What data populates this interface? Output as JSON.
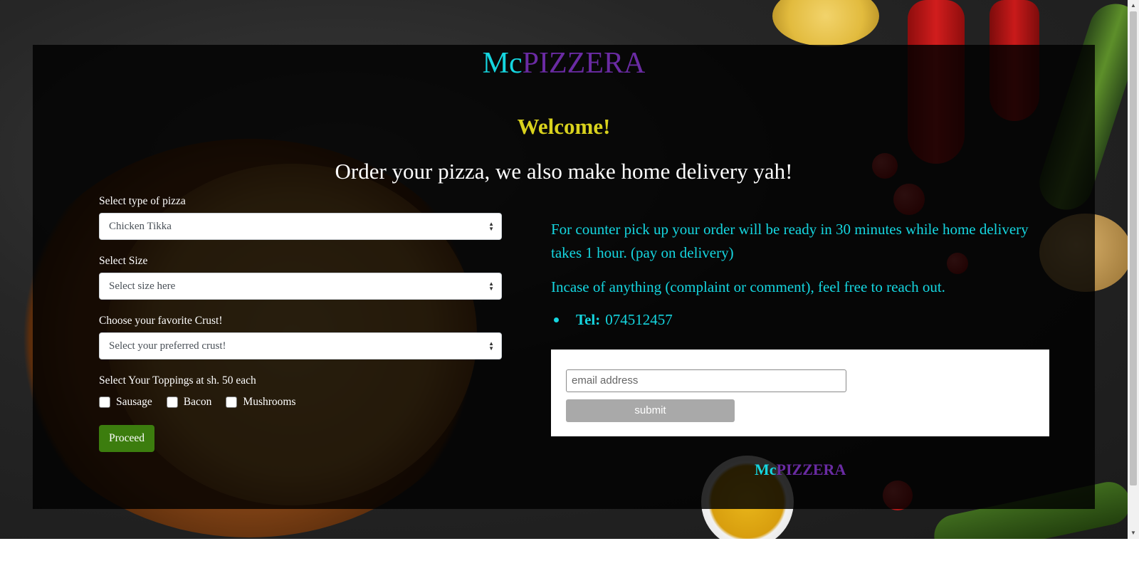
{
  "header": {
    "brand_prefix": "Mc",
    "brand_suffix": "PIZZERA",
    "welcome": "Welcome!",
    "subtitle": "Order your pizza, we also make home delivery yah!"
  },
  "form": {
    "pizza_type_label": "Select type of pizza",
    "pizza_type_value": "Chicken Tikka",
    "size_label": "Select Size",
    "size_value": "Select size here",
    "crust_label": "Choose your favorite Crust!",
    "crust_value": "Select your preferred crust!",
    "toppings_label": "Select Your Toppings at sh. 50 each",
    "toppings": [
      {
        "label": "Sausage",
        "checked": false
      },
      {
        "label": "Bacon",
        "checked": false
      },
      {
        "label": "Mushrooms",
        "checked": false
      }
    ],
    "proceed_label": "Proceed"
  },
  "info": {
    "delivery_text": "For counter pick up your order will be ready in 30 minutes while home delivery takes 1 hour. (pay on delivery)",
    "contact_text": "Incase of anything (complaint or comment), feel free to reach out.",
    "tel_label": "Tel:",
    "tel_value": "074512457"
  },
  "subscribe": {
    "email_placeholder": "email address",
    "submit_label": "submit"
  },
  "footer": {
    "brand_prefix": "Mc",
    "brand_suffix": "PIZZERA"
  },
  "colors": {
    "accent_cyan": "#15d6e0",
    "accent_purple": "#6a2ba3",
    "welcome_yellow": "#d9d21d",
    "proceed_green": "#3c7d0e"
  },
  "icons": {
    "select_arrow": "updown-arrows-icon",
    "scroll_up": "scroll-up-arrow-icon",
    "scroll_down": "scroll-down-arrow-icon"
  }
}
